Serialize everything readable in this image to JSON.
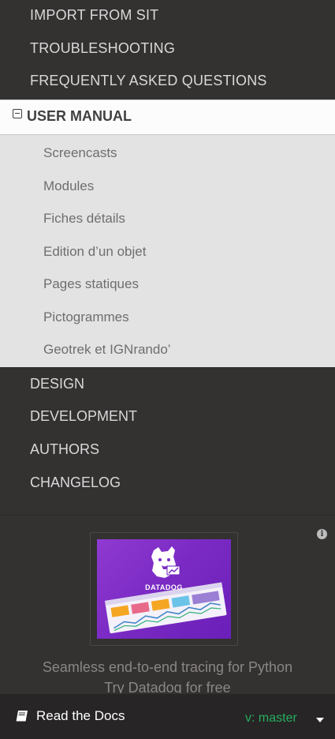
{
  "nav": {
    "top_items": [
      {
        "label": "IMPORT FROM SIT"
      },
      {
        "label": "TROUBLESHOOTING"
      },
      {
        "label": "FREQUENTLY ASKED QUESTIONS"
      }
    ],
    "current": {
      "label": "USER MANUAL"
    },
    "sub_items": [
      {
        "label": "Screencasts"
      },
      {
        "label": "Modules"
      },
      {
        "label": "Fiches détails"
      },
      {
        "label": "Edition d’un objet"
      },
      {
        "label": "Pages statiques"
      },
      {
        "label": "Pictogrammes"
      },
      {
        "label": "Geotrek et IGNrando’"
      }
    ],
    "lower_items": [
      {
        "label": "DESIGN"
      },
      {
        "label": "DEVELOPMENT"
      },
      {
        "label": "AUTHORS"
      },
      {
        "label": "CHANGELOG"
      }
    ]
  },
  "ad": {
    "brand": "DATADOG",
    "text": "Seamless end-to-end tracing for Python",
    "text_cut": "Try Datadog for free",
    "info_icon": "info-icon"
  },
  "footer": {
    "title": "Read the Docs",
    "version": "v: master",
    "icon": "book-icon"
  },
  "colors": {
    "sidebar_bg": "#343131",
    "current_bg": "#fcfcfc",
    "sub_bg": "#e3e3e3",
    "version_green": "#27ae60",
    "ad_purple": "#7b2bc4"
  }
}
